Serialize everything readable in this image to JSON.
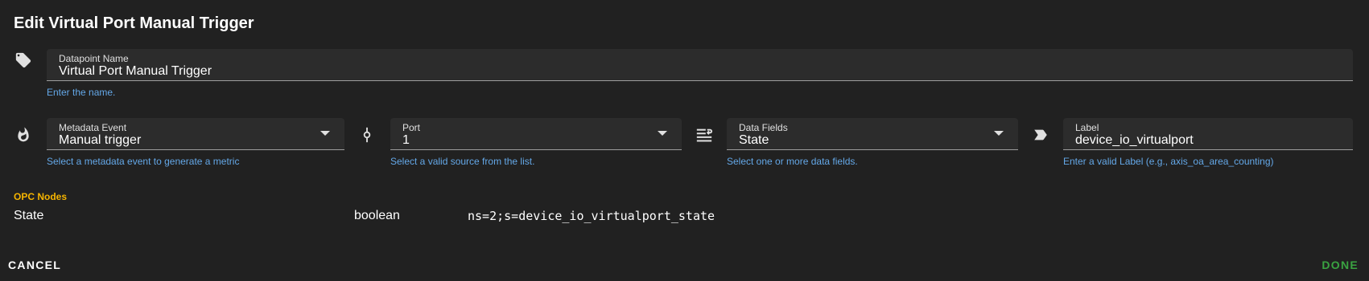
{
  "dialog": {
    "title": "Edit Virtual Port Manual Trigger"
  },
  "datapoint_name": {
    "label": "Datapoint Name",
    "value": "Virtual Port Manual Trigger",
    "hint": "Enter the name.",
    "icon": "tag-icon"
  },
  "metadata_event": {
    "label": "Metadata Event",
    "value": "Manual trigger",
    "hint": "Select a metadata event to generate a metric",
    "icon": "fire-icon"
  },
  "port": {
    "label": "Port",
    "value": "1",
    "hint": "Select a valid source from the list.",
    "icon": "source-commit-icon"
  },
  "data_fields": {
    "label": "Data Fields",
    "value": "State",
    "hint": "Select one or more data fields.",
    "icon": "format-list-icon"
  },
  "label_field": {
    "label": "Label",
    "value": "device_io_virtualport",
    "hint": "Enter a valid Label (e.g., axis_oa_area_counting)",
    "icon": "label-arrow-icon"
  },
  "opc_nodes": {
    "title": "OPC Nodes",
    "rows": [
      {
        "name": "State",
        "type": "boolean",
        "node_id": "ns=2;s=device_io_virtualport_state"
      }
    ]
  },
  "actions": {
    "cancel_label": "CANCEL",
    "done_label": "DONE"
  },
  "colors": {
    "background": "#212121",
    "field_background": "#2c2c2c",
    "hint": "#64a8e8",
    "section_title": "#f5b400",
    "done": "#3aa241"
  }
}
